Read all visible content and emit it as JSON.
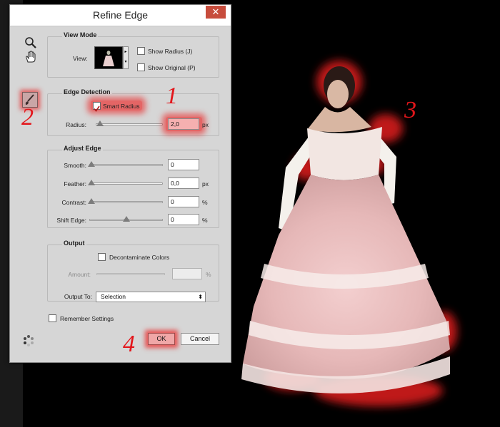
{
  "dialog": {
    "title": "Refine Edge",
    "close_glyph": "✕"
  },
  "view_mode": {
    "title": "View Mode",
    "view_label": "View:",
    "show_radius": "Show Radius (J)",
    "show_original": "Show Original (P)"
  },
  "edge_detection": {
    "title": "Edge Detection",
    "smart_radius": "Smart Radius",
    "smart_radius_checked": true,
    "radius_label": "Radius:",
    "radius_value": "2,0",
    "radius_unit": "px",
    "radius_slider_fraction": 0.05
  },
  "adjust_edge": {
    "title": "Adjust Edge",
    "smooth_label": "Smooth:",
    "smooth_value": "0",
    "feather_label": "Feather:",
    "feather_value": "0,0",
    "feather_unit": "px",
    "contrast_label": "Contrast:",
    "contrast_value": "0",
    "contrast_unit": "%",
    "shift_label": "Shift Edge:",
    "shift_value": "0",
    "shift_unit": "%"
  },
  "output": {
    "title": "Output",
    "decontaminate": "Decontaminate Colors",
    "amount_label": "Amount:",
    "amount_value": "",
    "amount_unit": "%",
    "output_to_label": "Output To:",
    "output_to_value": "Selection"
  },
  "footer": {
    "remember": "Remember Settings",
    "ok": "OK",
    "cancel": "Cancel"
  },
  "annotations": {
    "m1": "1",
    "m2": "2",
    "m3": "3",
    "m4": "4"
  },
  "colors": {
    "highlight": "#e32020",
    "marker": "#e3161b",
    "dialog_bg": "#d6d6d6"
  }
}
